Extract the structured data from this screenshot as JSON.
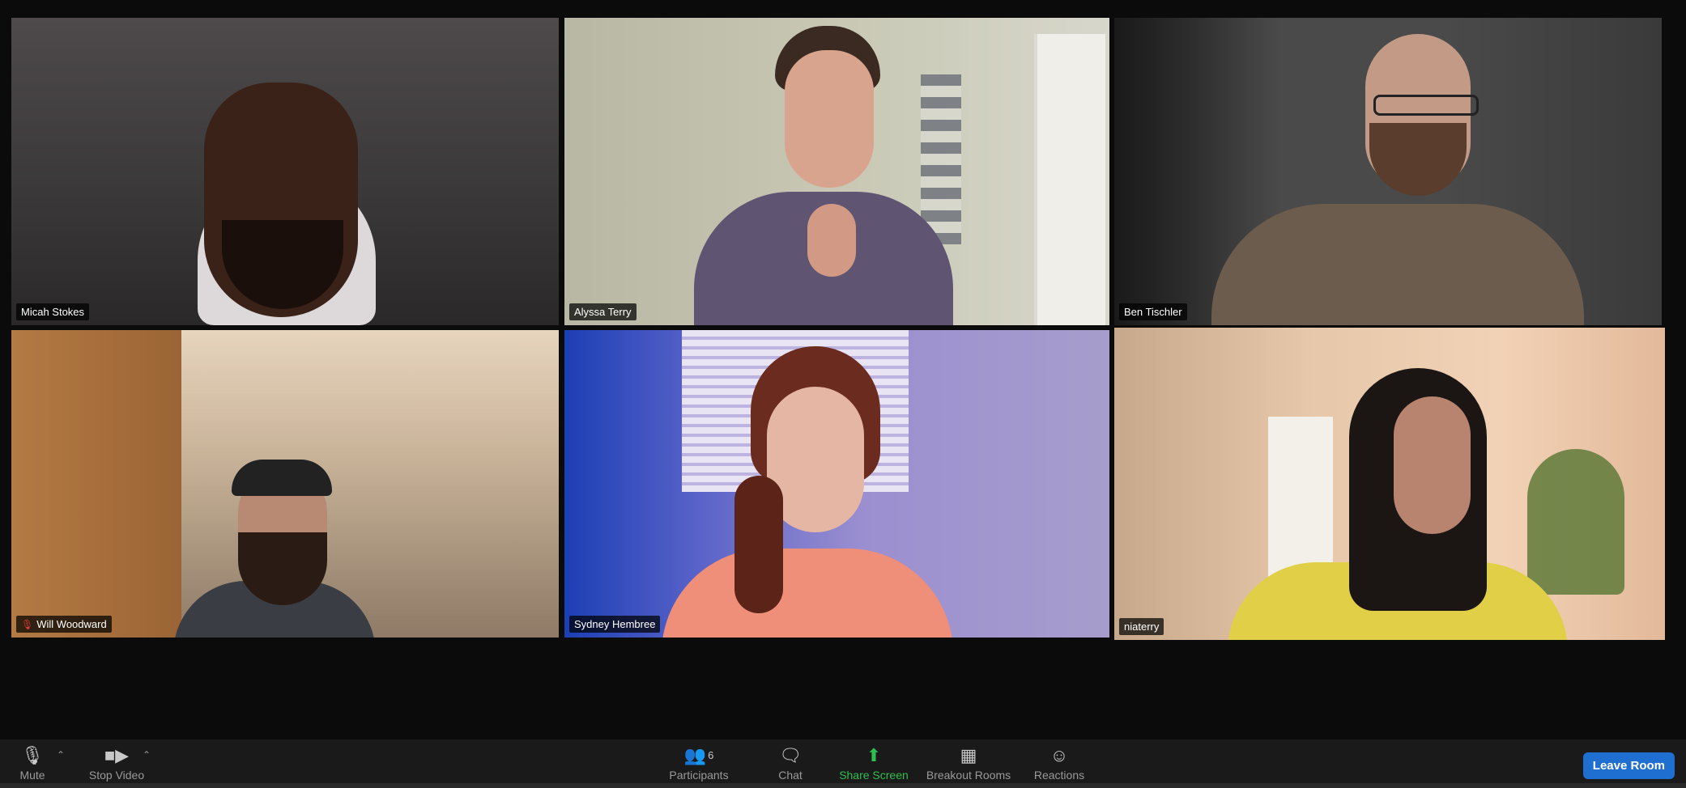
{
  "participants": [
    {
      "name": "Micah Stokes",
      "muted": false,
      "active": false
    },
    {
      "name": "Alyssa Terry",
      "muted": false,
      "active": false
    },
    {
      "name": "Ben Tischler",
      "muted": false,
      "active": false
    },
    {
      "name": "Will Woodward",
      "muted": true,
      "active": false
    },
    {
      "name": "Sydney Hembree",
      "muted": false,
      "active": false
    },
    {
      "name": "niaterry",
      "muted": false,
      "active": true
    }
  ],
  "toolbar": {
    "mute_label": "Mute",
    "video_label": "Stop Video",
    "participants_label": "Participants",
    "participants_count": "6",
    "chat_label": "Chat",
    "share_label": "Share Screen",
    "breakout_label": "Breakout Rooms",
    "reactions_label": "Reactions",
    "leave_label": "Leave Room"
  },
  "colors": {
    "active_speaker_border": "#d6d94a",
    "share_green": "#2dbf4f",
    "leave_blue": "#1f6fd1",
    "muted_red": "#e23b3b"
  },
  "icons": {
    "mute": "microphone-icon",
    "video": "video-camera-icon",
    "participants": "people-icon",
    "chat": "chat-bubble-icon",
    "share": "share-screen-icon",
    "breakout": "grid-icon",
    "reactions": "smiley-plus-icon"
  }
}
